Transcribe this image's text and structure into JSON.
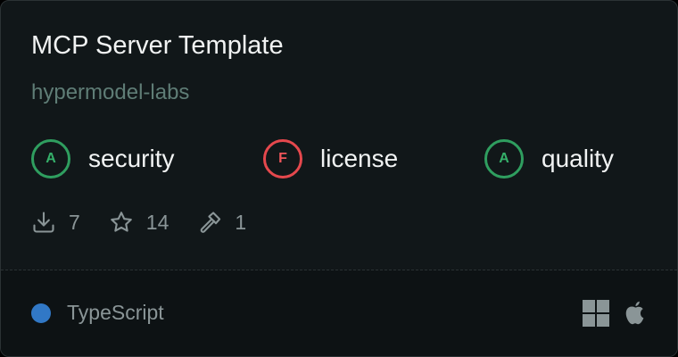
{
  "title": "MCP Server Template",
  "owner": "hypermodel-labs",
  "scores": [
    {
      "grade": "A",
      "label": "security",
      "status": "good"
    },
    {
      "grade": "F",
      "label": "license",
      "status": "bad"
    },
    {
      "grade": "A",
      "label": "quality",
      "status": "good"
    }
  ],
  "stats": {
    "downloads": "7",
    "stars": "14",
    "tools": "1"
  },
  "language": {
    "name": "TypeScript",
    "color": "#3178c6"
  },
  "platforms": [
    "windows-icon",
    "apple-icon"
  ],
  "colors": {
    "grade_good": "#2f9e5f",
    "grade_bad": "#e5484d",
    "owner_text": "#5f7d76"
  }
}
